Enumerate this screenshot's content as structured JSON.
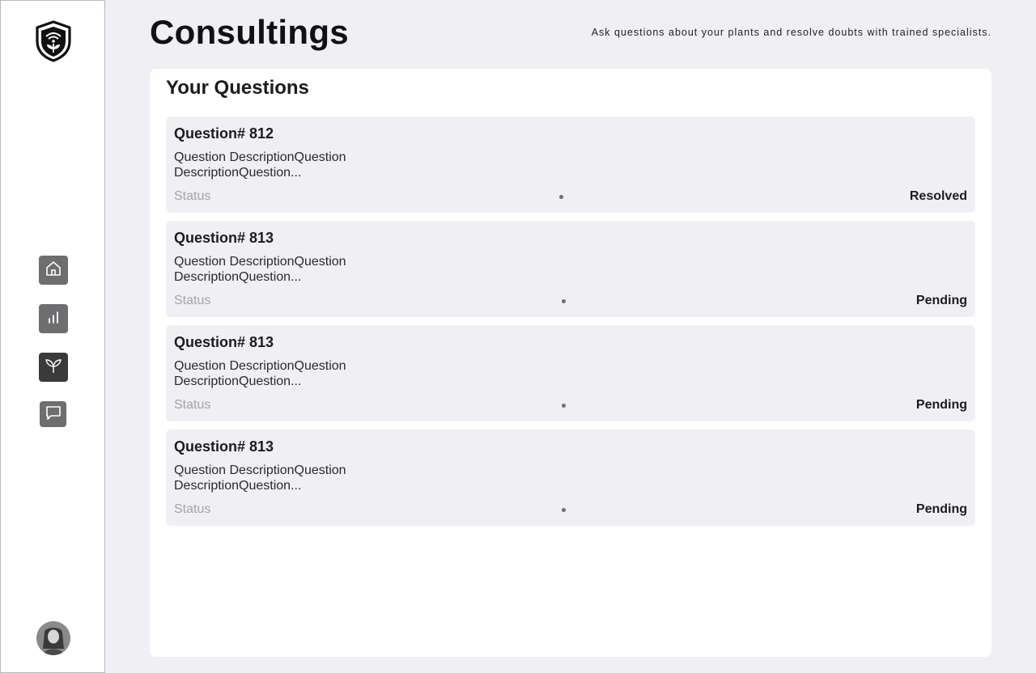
{
  "header": {
    "title": "Consultings",
    "subtitle": "Ask questions about your plants and resolve doubts with trained specialists."
  },
  "sidebar": {
    "logo_icon": "shield-plant-wifi-icon",
    "items": [
      {
        "icon": "home-icon",
        "active": false
      },
      {
        "icon": "bar-chart-icon",
        "active": false
      },
      {
        "icon": "plant-icon",
        "active": true
      },
      {
        "icon": "chat-icon",
        "active": false
      }
    ],
    "avatar_icon": "user-avatar"
  },
  "panel": {
    "title": "Your Questions",
    "questions": [
      {
        "title": "Question# 812",
        "description": "Question DescriptionQuestion DescriptionQuestion...",
        "status_label": "Status",
        "status": "Resolved"
      },
      {
        "title": "Question# 813",
        "description": "Question DescriptionQuestion DescriptionQuestion...",
        "status_label": "Status",
        "status": "Pending"
      },
      {
        "title": "Question# 813",
        "description": "Question DescriptionQuestion DescriptionQuestion...",
        "status_label": "Status",
        "status": "Pending"
      },
      {
        "title": "Question# 813",
        "description": "Question DescriptionQuestion DescriptionQuestion...",
        "status_label": "Status",
        "status": "Pending"
      }
    ]
  },
  "colors": {
    "background": "#f0eff4",
    "panel": "#ffffff",
    "card": "#f0eff4",
    "nav_button": "#6e6e70",
    "nav_button_active": "#3a3a3c",
    "muted_text": "#a3a3a8"
  }
}
